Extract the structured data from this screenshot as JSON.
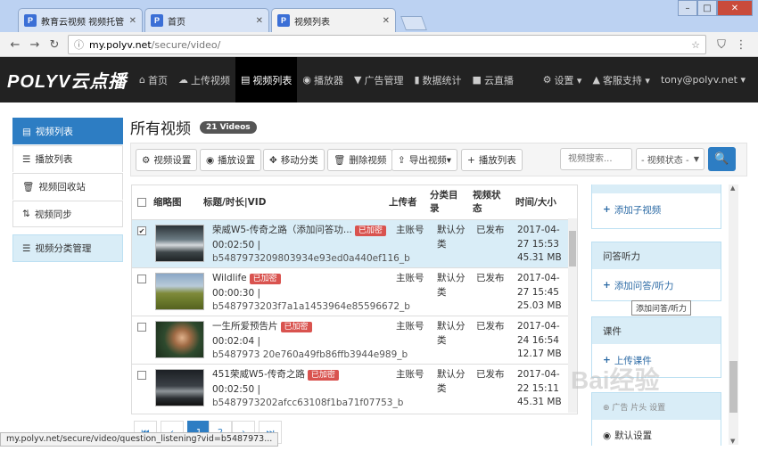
{
  "browser": {
    "tabs": [
      {
        "icon": "P",
        "title": "教育云视频 视频托管 _ 保"
      },
      {
        "icon": "P",
        "title": "首页"
      },
      {
        "icon": "P",
        "title": "视频列表"
      }
    ],
    "window_controls": [
      "–",
      "□",
      "✕"
    ],
    "url_host": "my.polyv.net",
    "url_path": "/secure/video/",
    "status_url": "my.polyv.net/secure/video/question_listening?vid=b5487973..."
  },
  "nav": {
    "logo": "POLYV云点播",
    "items": [
      {
        "icon": "⌂",
        "label": "首页"
      },
      {
        "icon": "☁",
        "label": "上传视频"
      },
      {
        "icon": "▤",
        "label": "视频列表"
      },
      {
        "icon": "◉",
        "label": "播放器"
      },
      {
        "icon": "▼",
        "label": "广告管理"
      },
      {
        "icon": "▮",
        "label": "数据统计"
      },
      {
        "icon": "■",
        "label": "云直播"
      }
    ],
    "right": [
      {
        "icon": "⚙",
        "label": "设置 ▾"
      },
      {
        "icon": "▲",
        "label": "客服支持 ▾"
      },
      {
        "icon": "",
        "label": "tony@polyv.net ▾"
      }
    ]
  },
  "sidebar": {
    "items": [
      {
        "icon": "▤",
        "label": "视频列表"
      },
      {
        "icon": "☰",
        "label": "播放列表"
      },
      {
        "icon": "🗑",
        "label": "视频回收站"
      },
      {
        "icon": "⇅",
        "label": "视频同步"
      }
    ],
    "category": {
      "icon": "☰",
      "label": "视频分类管理"
    }
  },
  "main": {
    "title": "所有视频",
    "count": "21 Videos",
    "toolbar": [
      {
        "icon": "⚙",
        "label": "视频设置"
      },
      {
        "icon": "◉",
        "label": "播放设置"
      },
      {
        "icon": "✥",
        "label": "移动分类"
      },
      {
        "icon": "🗑",
        "label": "删除视频"
      },
      {
        "icon": "⇪",
        "label": "导出视频▾"
      },
      {
        "icon": "+",
        "label": "播放列表"
      }
    ],
    "search_placeholder": "视频搜索...",
    "status_select": "- 视频状态 -",
    "search_icon": "🔍"
  },
  "table": {
    "headers": [
      "缩略图",
      "标题/时长|VID",
      "上传者",
      "分类目录",
      "视频状态",
      "时间/大小"
    ],
    "encrypted_label": "已加密",
    "rows": [
      {
        "checked": true,
        "title": "荣威W5-传奇之路（添加问答功...",
        "duration": "00:02:50 |",
        "vid": "b5487973209803934e93ed0a440ef116_b",
        "uploader": "主账号",
        "category": "默认分类",
        "status": "已发布",
        "date": "2017-04-27 15:53",
        "size": "45.31 MB"
      },
      {
        "checked": false,
        "title": "Wildlife",
        "duration": "00:00:30 |",
        "vid": "b5487973203f7a1a1453964e85596672_b",
        "uploader": "主账号",
        "category": "默认分类",
        "status": "已发布",
        "date": "2017-04-27 15:45",
        "size": "25.03 MB"
      },
      {
        "checked": false,
        "title": "一生所爱预告片",
        "duration": "00:02:04 |",
        "vid": "b5487973 20e760a49fb86ffb3944e989_b",
        "uploader": "主账号",
        "category": "默认分类",
        "status": "已发布",
        "date": "2017-04-24 16:54",
        "size": "12.17 MB"
      },
      {
        "checked": false,
        "title": "451荣威W5-传奇之路",
        "duration": "00:02:50 |",
        "vid": "b5487973202afcc63108f1ba71f07753_b",
        "uploader": "主账号",
        "category": "默认分类",
        "status": "已发布",
        "date": "2017-04-22 15:11",
        "size": "45.31 MB"
      }
    ]
  },
  "pager": [
    "⏮",
    "‹",
    "1",
    "2",
    "›",
    "⏭"
  ],
  "right_panel": {
    "add_sub_video": "添加子视频",
    "qa_header": "问答听力",
    "add_qa": "添加问答/听力",
    "tooltip": "添加问答/听力",
    "course_header": "课件",
    "upload_course": "上传课件",
    "partial_header": "⊕ 广告  片头  设置",
    "default_setting": "默认设置"
  },
  "watermark": "Bai经验",
  "colors": {
    "brand": "#2d7dc3",
    "nav_bg": "#222222",
    "encrypted": "#d9534f",
    "selected_row": "#d9edf7"
  }
}
